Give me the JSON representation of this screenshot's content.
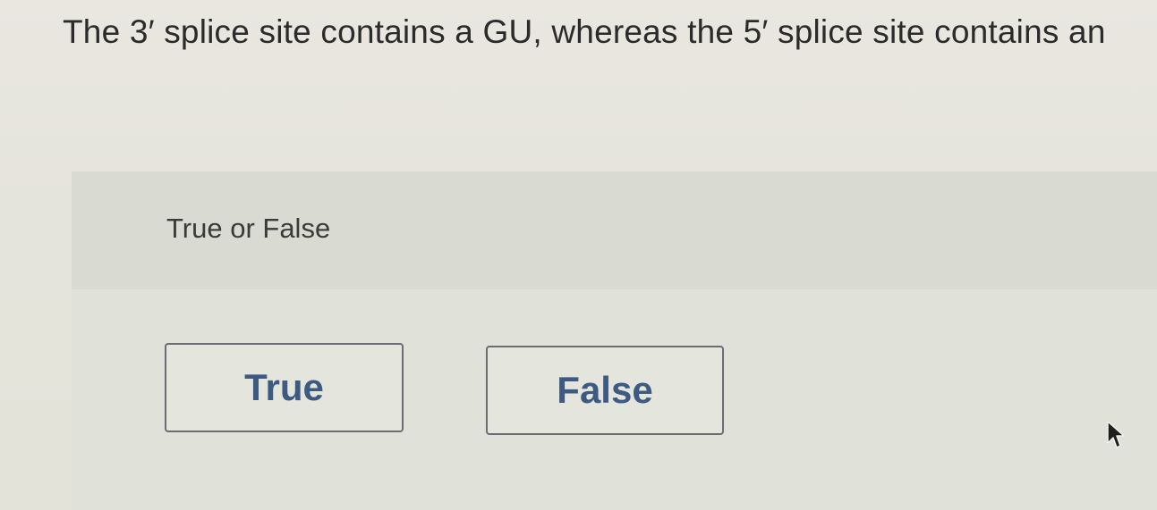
{
  "question": {
    "text": "The 3′ splice site contains a GU, whereas the 5′ splice site contains an"
  },
  "prompt": {
    "label": "True or False"
  },
  "answers": [
    {
      "label": "True"
    },
    {
      "label": "False"
    }
  ],
  "colors": {
    "button_text": "#3d5a82",
    "button_border": "#6a6d72",
    "question_text": "#2b2b2b"
  },
  "icons": {
    "cursor": "mouse-pointer-icon"
  }
}
